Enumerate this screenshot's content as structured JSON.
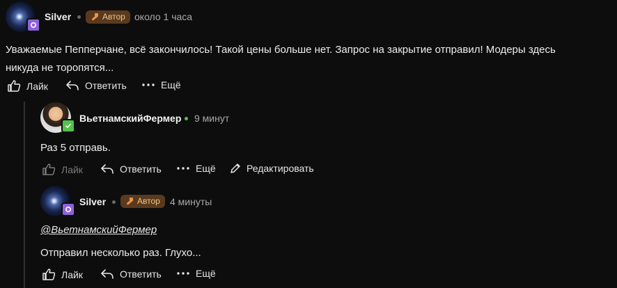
{
  "comment1": {
    "author": "Silver",
    "author_badge": "Автор",
    "time": "около 1 часа",
    "text_line1": "Уважаемые Пепперчане, всё закончилось! Такой цены больше нет. Запрос на закрытие отправил! Модеры здесь",
    "text_line2": "никуда не торопятся...",
    "actions": {
      "like": "Лайк",
      "reply": "Ответить",
      "more": "Ещё"
    }
  },
  "comment2": {
    "author": "ВьетнамскийФермер",
    "time": "9 минут",
    "text": "Раз 5 отправь.",
    "actions": {
      "like": "Лайк",
      "reply": "Ответить",
      "more": "Ещё",
      "edit": "Редактировать"
    }
  },
  "comment3": {
    "author": "Silver",
    "author_badge": "Автор",
    "time": "4 минуты",
    "mention": "@ВьетнамскийФермер",
    "text": "Отправил несколько раз. Глухо...",
    "actions": {
      "like": "Лайк",
      "reply": "Ответить",
      "more": "Ещё"
    }
  },
  "colors": {
    "background": "#0d0d0d",
    "author_badge_bg": "#5a3a1e",
    "author_badge_text": "#f1c38b",
    "online_dot": "#56c04a",
    "avatar_badge_purple": "#8e63d8",
    "avatar_badge_green": "#53c24a"
  }
}
